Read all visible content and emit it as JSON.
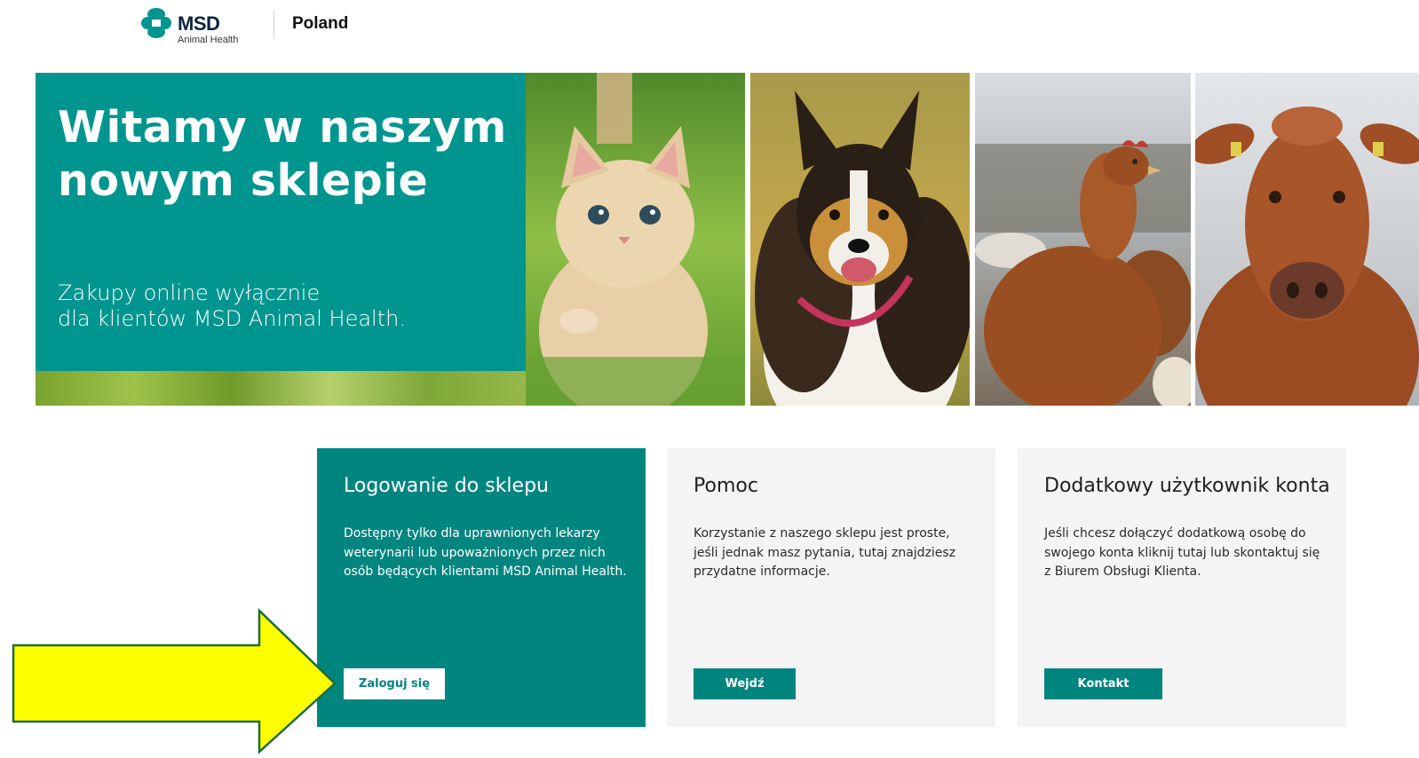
{
  "header": {
    "brand": "MSD",
    "brand_sub": "Animal Health",
    "country": "Poland"
  },
  "hero": {
    "title_line1": "Witamy w naszym",
    "title_line2": "nowym sklepie",
    "subtitle_line1": "Zakupy online wyłącznie",
    "subtitle_line2": "dla klientów MSD Animal Health.",
    "photos": [
      "kitten-photo",
      "collie-dog-photo",
      "hen-photo",
      "cow-photo"
    ]
  },
  "cards": [
    {
      "title": "Logowanie do sklepu",
      "text": "Dostępny tylko dla uprawnionych lekarzy weterynarii lub upoważnionych przez nich osób będących klientami MSD Animal Health.",
      "button": "Zaloguj się"
    },
    {
      "title": "Pomoc",
      "text": "Korzystanie z naszego sklepu jest proste, jeśli jednak masz pytania, tutaj znajdziesz przydatne informacje.",
      "button": "Wejdź"
    },
    {
      "title": "Dodatkowy użytkownik konta",
      "text": "Jeśli chcesz dołączyć dodatkową osobę do swojego konta kliknij tutaj lub skontaktuj się z Biurem Obsługi Klienta.",
      "button": "Kontakt"
    }
  ],
  "colors": {
    "teal": "#00958f",
    "teal_dark": "#00857f",
    "card_bg": "#f4f4f4",
    "annotation_arrow": "#ffff00"
  }
}
